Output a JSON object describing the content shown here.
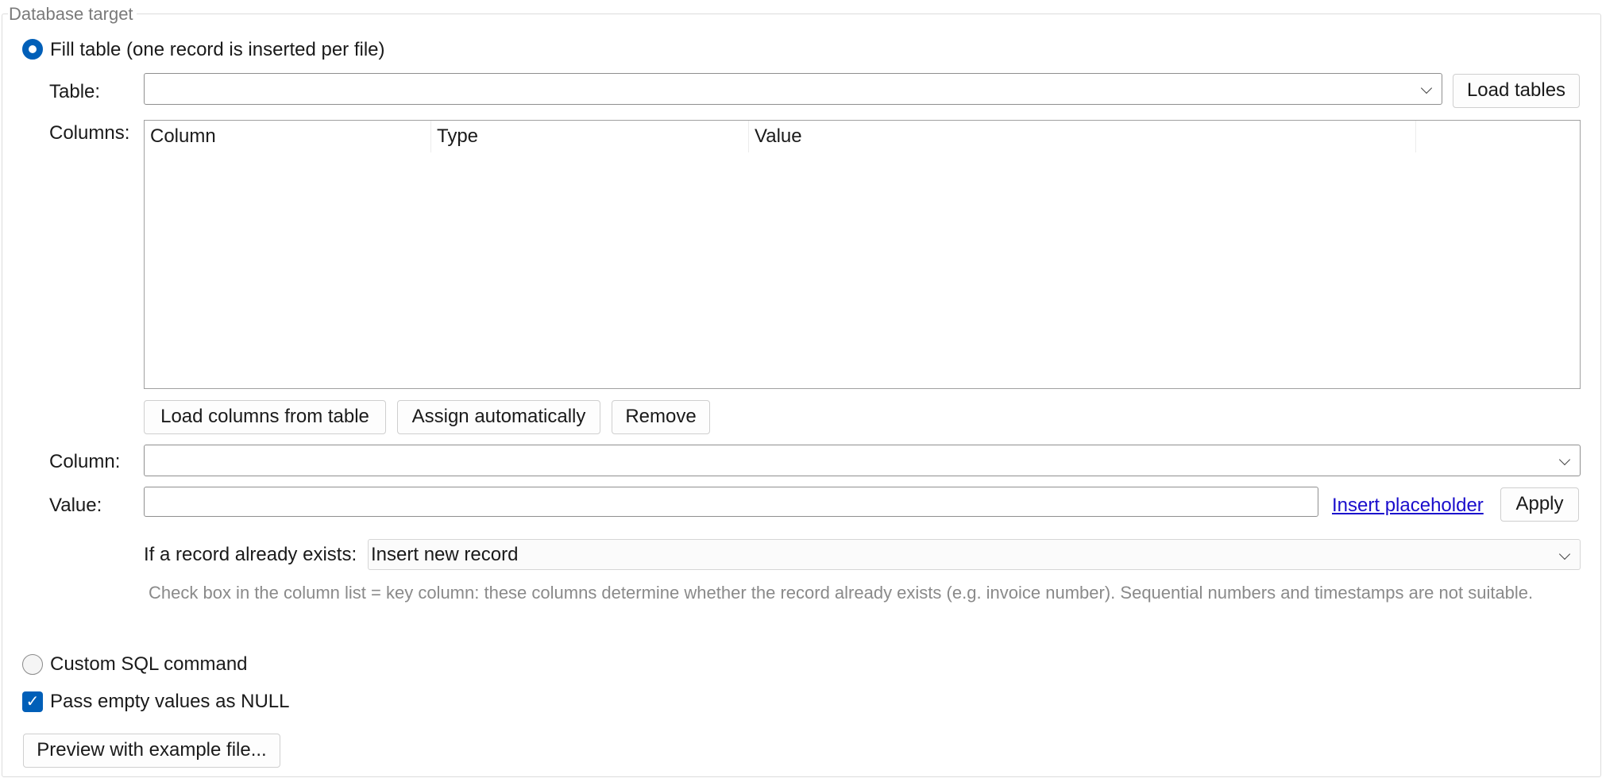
{
  "group": {
    "title": "Database target"
  },
  "fill_table": {
    "label": "Fill table (one record is inserted per file)",
    "selected": true
  },
  "table": {
    "label": "Table:",
    "value": "",
    "load_button": "Load tables"
  },
  "columns": {
    "label": "Columns:",
    "headers": [
      "Column",
      "Type",
      "Value"
    ],
    "rows": [],
    "buttons": {
      "load": "Load columns from table",
      "assign": "Assign automatically",
      "remove": "Remove"
    }
  },
  "column_field": {
    "label": "Column:",
    "value": ""
  },
  "value_field": {
    "label": "Value:",
    "value": "",
    "insert_placeholder": "Insert placeholder",
    "apply": "Apply"
  },
  "existing": {
    "label": "If a record already exists:",
    "selected": "Insert new record",
    "hint": "Check box in the column list = key column: these columns determine whether the record already exists (e.g. invoice number). Sequential numbers and timestamps are not suitable."
  },
  "custom_sql": {
    "label": "Custom SQL command",
    "selected": false
  },
  "null_option": {
    "label": "Pass empty values as NULL",
    "checked": true
  },
  "preview": {
    "label": "Preview with example file..."
  },
  "colors": {
    "accent": "#005fb8",
    "link": "#1a0dcc",
    "hint_text": "#8a8a8a"
  }
}
